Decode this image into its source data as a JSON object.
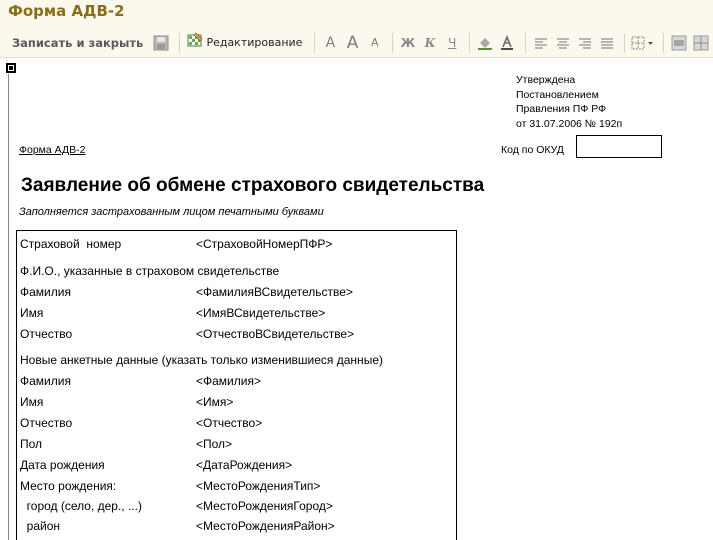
{
  "window": {
    "title": "Форма АДВ-2"
  },
  "toolbar": {
    "save_close_label": "Записать и закрыть",
    "save_icon": "floppy-disk-icon",
    "edit_label": "Редактирование",
    "edit_icon": "checkered-edit-icon",
    "font_buttons": [
      "A",
      "A",
      "A"
    ],
    "style_buttons": [
      "Ж",
      "К",
      "Ч"
    ]
  },
  "document": {
    "approval_lines": [
      "Утверждена",
      "Постановлением",
      "Правления ПФ РФ",
      "от 31.07.2006 № 192п"
    ],
    "form_name": "Форма АДВ-2",
    "okud_label": "Код по ОКУД",
    "title": "Заявление об обмене страхового свидетельства",
    "subtitle": "Заполняется застрахованным лицом печатными буквами",
    "insurance_number": {
      "label": "Страховой  номер",
      "value": "<СтраховойНомерПФР>"
    },
    "cert_section": {
      "header": "Ф.И.О., указанные в страховом свидетельстве",
      "rows": [
        {
          "label": "Фамилия",
          "value": "<ФамилияВСвидетельстве>"
        },
        {
          "label": "Имя",
          "value": "<ИмяВСвидетельстве>"
        },
        {
          "label": "Отчество",
          "value": "<ОтчествоВСвидетельстве>"
        }
      ]
    },
    "new_section": {
      "header": "Новые анкетные данные (указать только изменившиеся данные)",
      "rows": [
        {
          "label": "Фамилия",
          "value": "<Фамилия>"
        },
        {
          "label": "Имя",
          "value": "<Имя>"
        },
        {
          "label": "Отчество",
          "value": "<Отчество>"
        },
        {
          "label": "Пол",
          "value": "<Пол>"
        },
        {
          "label": "Дата рождения",
          "value": "<ДатаРождения>"
        },
        {
          "label": "Место рождения:",
          "value": "<МестоРожденияТип>"
        },
        {
          "label": "  город (село, дер., ...)",
          "value": "<МестоРожденияГород>"
        },
        {
          "label": "  район",
          "value": "<МестоРожденияРайон>"
        }
      ]
    }
  }
}
